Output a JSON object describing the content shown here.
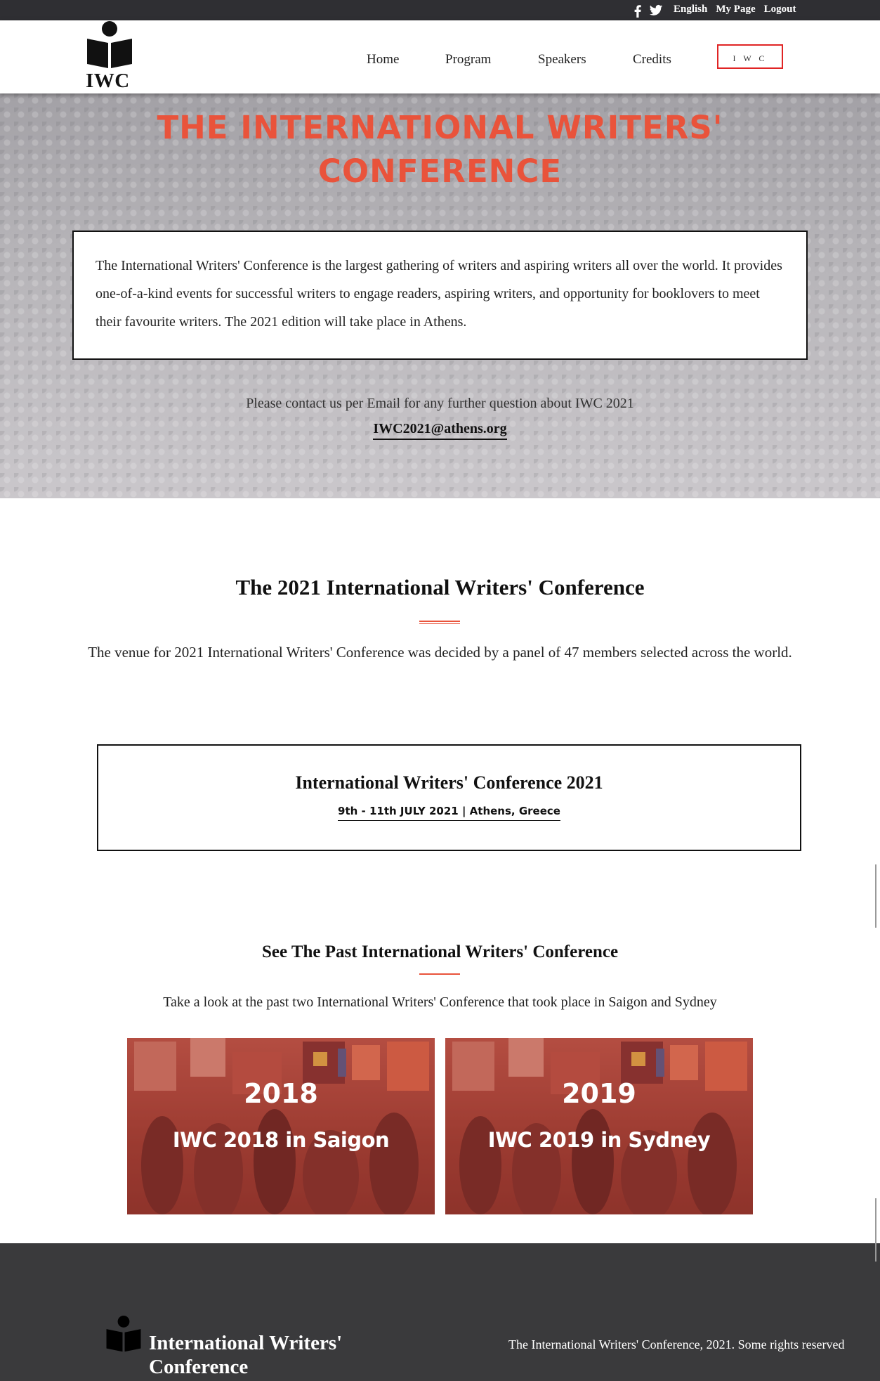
{
  "topbar": {
    "icons": [
      "facebook-icon",
      "twitter-icon"
    ],
    "links": [
      "English",
      "My Page",
      "Logout"
    ]
  },
  "header": {
    "logo_text": "IWC",
    "nav": [
      "Home",
      "Program",
      "Speakers",
      "Credits"
    ],
    "nav_active": "I W C"
  },
  "hero": {
    "title_line1": "THE INTERNATIONAL WRITERS'",
    "title_line2": "CONFERENCE",
    "description": "The International Writers' Conference is the largest gathering of writers and aspiring writers all over the world. It provides one-of-a-kind events for successful writers to engage readers, aspiring writers, and opportunity for booklovers to meet their favourite writers. The 2021 edition will take place in Athens.",
    "contact_text": "Please contact us per Email for any further question about IWC 2021",
    "email": "IWC2021@athens.org"
  },
  "section2021": {
    "title": "The 2021 International Writers' Conference",
    "text": "The venue for 2021 International Writers' Conference was decided by a panel of 47 members selected across the world.",
    "event_title": "International Writers' Conference 2021",
    "event_date": "9th - 11th JULY 2021 | Athens, Greece"
  },
  "past": {
    "title": "See The Past International Writers' Conference",
    "text": "Take a look at the past two International Writers' Conference that took place in Saigon and Sydney",
    "cards": [
      {
        "year": "2018",
        "label": "IWC 2018 in Saigon"
      },
      {
        "year": "2019",
        "label": "IWC 2019 in Sydney"
      }
    ]
  },
  "footer": {
    "name": "International Writers' Conference",
    "rights": "The International Writers' Conference, 2021. Some rights reserved"
  },
  "colors": {
    "accent": "#e9533b",
    "nav_active_border": "#e02424",
    "topbar": "#2f2f33",
    "footer": "#3a3a3c"
  }
}
